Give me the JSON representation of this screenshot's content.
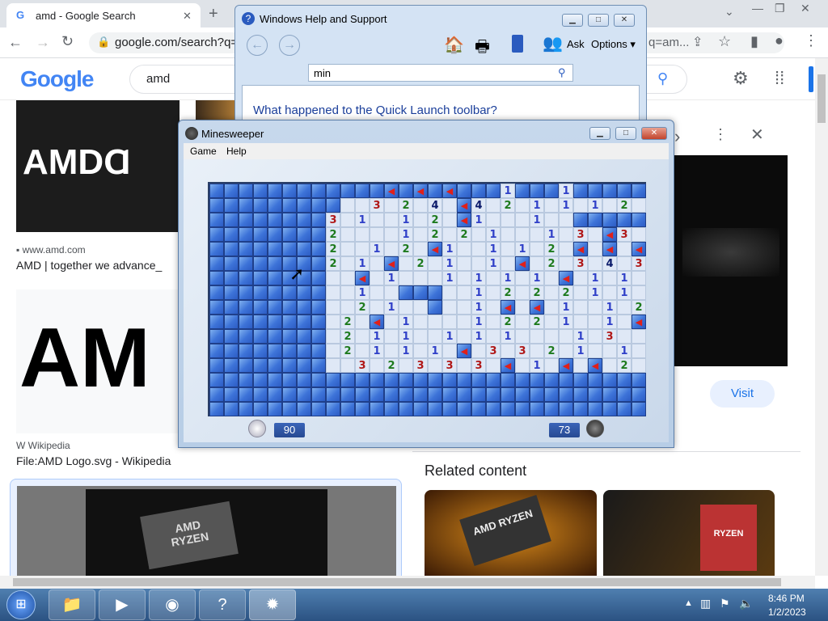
{
  "browser": {
    "tab_title": "amd - Google Search",
    "tab_close": "✕",
    "new_tab": "+",
    "url": "google.com/search?q=a",
    "url_tail": "q=am...",
    "window_min": "—",
    "window_max": "❐",
    "window_close": "✕",
    "tab_menu": "⌄"
  },
  "google": {
    "logo": "Google",
    "search_value": "amd",
    "result1_source": "www.amd.com",
    "result1_title": "AMD | together we advance_",
    "result1_logo": "AMDⱭ",
    "result2_source": "Wikipedia",
    "result2_title": "File:AMD Logo.svg - Wikipedia",
    "result2_logo": "AM",
    "visit_label": "Visit",
    "related_heading": "Related content",
    "ryzen_label": "RYZEN",
    "amd_label": "AMD"
  },
  "help_window": {
    "title": "Windows Help and Support",
    "ask": "Ask",
    "options": "Options",
    "search_value": "min",
    "link": "What happened to the Quick Launch toolbar?"
  },
  "minesweeper": {
    "title": "Minesweeper",
    "menu": [
      "Game",
      "Help"
    ],
    "time": "90",
    "mines_left": "73",
    "rows": [
      "............F.F.F...1...1.....",
      "...........3.2.4.F4.2.1.1.1.2.1",
      "........3.1..1.2.F1...1.......",
      "........2....1.2.2.1...1.3.F3.",
      "........2..1.2.F1..1.1.2.F.F.F",
      "........2.1.F.2.1..1.F.2.3.4.3",
      "..........F.1...1.1.1.1.F.1.1.",
      "..........1.......1.2.2.2.1.1.",
      "..........2.1.....1.F.F.1..1.2",
      ".........2.F.1....1.2.2.1..1.F",
      ".........2.1.1..1.1.1....1.3..",
      ".........2.1.1.1.F.3.3.2.1..1.",
      "..........3.2.3.3.3.F.1.F.F.2.",
      "..............................",
      "..............................",
      ".............................."
    ]
  },
  "taskbar": {
    "time": "8:46 PM",
    "date": "1/2/2023"
  }
}
